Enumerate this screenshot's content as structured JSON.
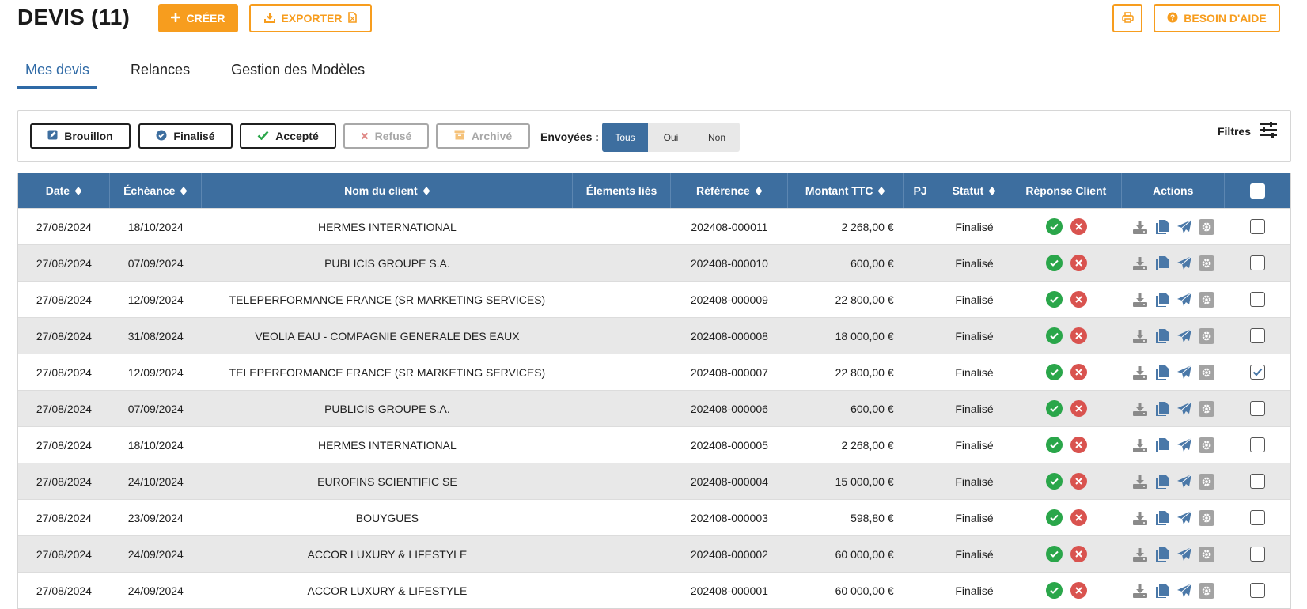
{
  "header": {
    "title": "DEVIS (11)",
    "create_label": "CRÉER",
    "export_label": "EXPORTER",
    "help_label": "BESOIN D'AIDE"
  },
  "tabs": [
    {
      "label": "Mes devis",
      "active": true
    },
    {
      "label": "Relances",
      "active": false
    },
    {
      "label": "Gestion des Modèles",
      "active": false
    }
  ],
  "filters": {
    "status_buttons": [
      {
        "label": "Brouillon",
        "enabled": true
      },
      {
        "label": "Finalisé",
        "enabled": true
      },
      {
        "label": "Accepté",
        "enabled": true
      },
      {
        "label": "Refusé",
        "enabled": false
      },
      {
        "label": "Archivé",
        "enabled": false
      }
    ],
    "sent_label": "Envoyées :",
    "sent_options": [
      "Tous",
      "Oui",
      "Non"
    ],
    "sent_selected": "Tous",
    "filters_label": "Filtres"
  },
  "table": {
    "columns": {
      "date": "Date",
      "echeance": "Échéance",
      "client": "Nom du client",
      "elements": "Élements liés",
      "reference": "Référence",
      "montant": "Montant TTC",
      "pj": "PJ",
      "statut": "Statut",
      "reponse": "Réponse Client",
      "actions": "Actions"
    },
    "rows": [
      {
        "date": "27/08/2024",
        "echeance": "18/10/2024",
        "client": "HERMES INTERNATIONAL",
        "elements": "",
        "reference": "202408-000011",
        "montant": "2 268,00 €",
        "pj": "",
        "statut": "Finalisé",
        "checked": false
      },
      {
        "date": "27/08/2024",
        "echeance": "07/09/2024",
        "client": "PUBLICIS GROUPE S.A.",
        "elements": "",
        "reference": "202408-000010",
        "montant": "600,00 €",
        "pj": "",
        "statut": "Finalisé",
        "checked": false
      },
      {
        "date": "27/08/2024",
        "echeance": "12/09/2024",
        "client": "TELEPERFORMANCE FRANCE (SR MARKETING SERVICES)",
        "elements": "",
        "reference": "202408-000009",
        "montant": "22 800,00 €",
        "pj": "",
        "statut": "Finalisé",
        "checked": false
      },
      {
        "date": "27/08/2024",
        "echeance": "31/08/2024",
        "client": "VEOLIA EAU - COMPAGNIE GENERALE DES EAUX",
        "elements": "",
        "reference": "202408-000008",
        "montant": "18 000,00 €",
        "pj": "",
        "statut": "Finalisé",
        "checked": false
      },
      {
        "date": "27/08/2024",
        "echeance": "12/09/2024",
        "client": "TELEPERFORMANCE FRANCE (SR MARKETING SERVICES)",
        "elements": "",
        "reference": "202408-000007",
        "montant": "22 800,00 €",
        "pj": "",
        "statut": "Finalisé",
        "checked": true
      },
      {
        "date": "27/08/2024",
        "echeance": "07/09/2024",
        "client": "PUBLICIS GROUPE S.A.",
        "elements": "",
        "reference": "202408-000006",
        "montant": "600,00 €",
        "pj": "",
        "statut": "Finalisé",
        "checked": false
      },
      {
        "date": "27/08/2024",
        "echeance": "18/10/2024",
        "client": "HERMES INTERNATIONAL",
        "elements": "",
        "reference": "202408-000005",
        "montant": "2 268,00 €",
        "pj": "",
        "statut": "Finalisé",
        "checked": false
      },
      {
        "date": "27/08/2024",
        "echeance": "24/10/2024",
        "client": "EUROFINS SCIENTIFIC SE",
        "elements": "",
        "reference": "202408-000004",
        "montant": "15 000,00 €",
        "pj": "",
        "statut": "Finalisé",
        "checked": false
      },
      {
        "date": "27/08/2024",
        "echeance": "23/09/2024",
        "client": "BOUYGUES",
        "elements": "",
        "reference": "202408-000003",
        "montant": "598,80 €",
        "pj": "",
        "statut": "Finalisé",
        "checked": false
      },
      {
        "date": "27/08/2024",
        "echeance": "24/09/2024",
        "client": "ACCOR LUXURY & LIFESTYLE",
        "elements": "",
        "reference": "202408-000002",
        "montant": "60 000,00 €",
        "pj": "",
        "statut": "Finalisé",
        "checked": false
      },
      {
        "date": "27/08/2024",
        "echeance": "24/09/2024",
        "client": "ACCOR LUXURY & LIFESTYLE",
        "elements": "",
        "reference": "202408-000001",
        "montant": "60 000,00 €",
        "pj": "",
        "statut": "Finalisé",
        "checked": false
      }
    ]
  },
  "colors": {
    "accent": "#f79d1e",
    "header_blue": "#3d6e9f",
    "tab_active": "#2f6aa6",
    "accept_green": "#2aa64a",
    "refuse_red": "#d9534f",
    "action_grey": "#8a8a8a",
    "action_blue": "#4a78a8"
  },
  "icons": {
    "create": "plus-icon",
    "export": "download-file-icon",
    "print": "printer-icon",
    "help": "question-circle-icon",
    "filters": "sliders-icon",
    "row_actions": [
      "download-icon",
      "copy-icon",
      "send-icon",
      "settings-icon"
    ],
    "row_response": [
      "accept-check-icon",
      "refuse-x-icon"
    ]
  }
}
